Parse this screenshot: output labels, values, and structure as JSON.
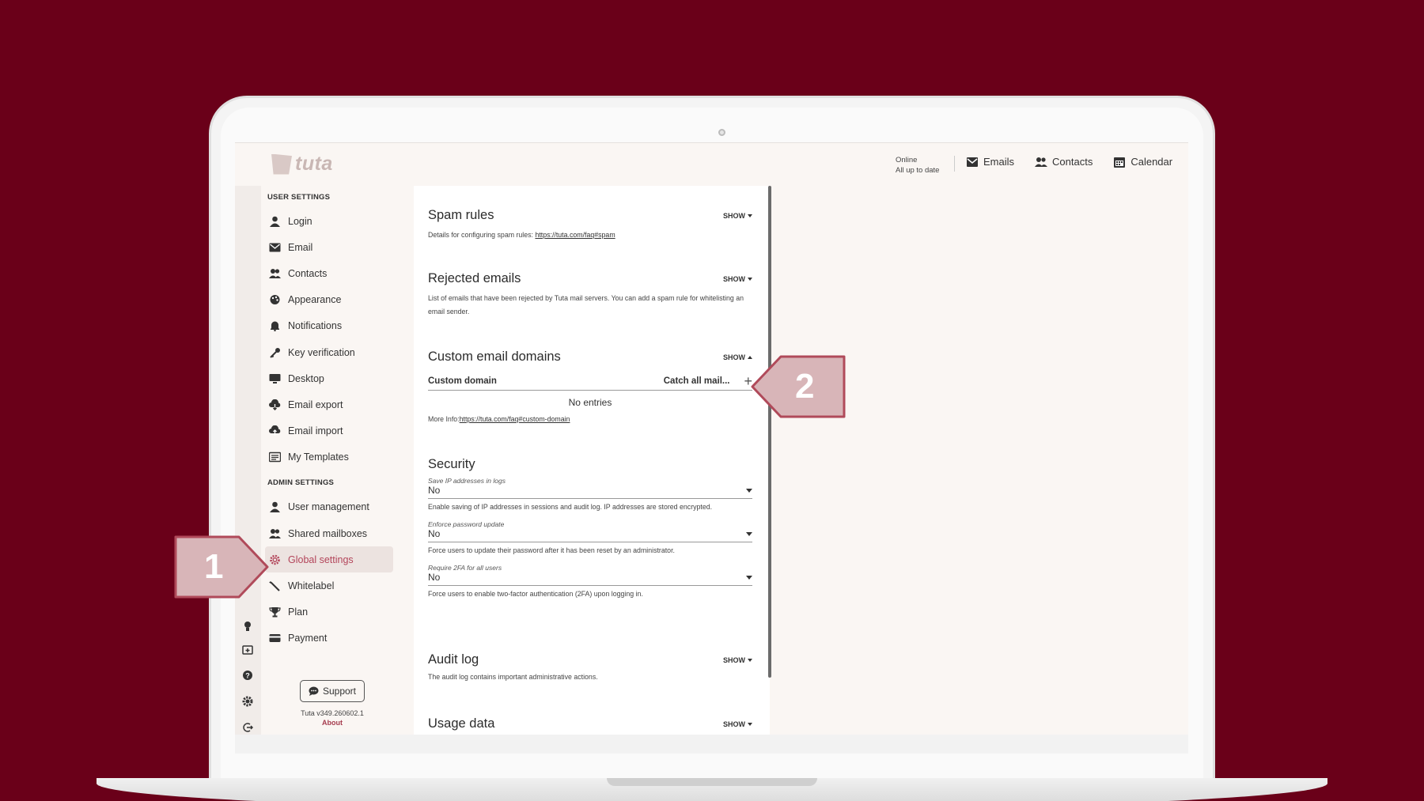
{
  "header": {
    "logo_text": "tuta",
    "status_line1": "Online",
    "status_line2": "All up to date",
    "nav": [
      {
        "label": "Emails",
        "icon": "mail-icon"
      },
      {
        "label": "Contacts",
        "icon": "contacts-icon"
      },
      {
        "label": "Calendar",
        "icon": "calendar-icon"
      }
    ]
  },
  "sidebar": {
    "user_settings_label": "USER SETTINGS",
    "user_items": [
      {
        "label": "Login",
        "icon": "person-icon"
      },
      {
        "label": "Email",
        "icon": "mail-icon"
      },
      {
        "label": "Contacts",
        "icon": "contacts-icon"
      },
      {
        "label": "Appearance",
        "icon": "palette-icon"
      },
      {
        "label": "Notifications",
        "icon": "bell-icon"
      },
      {
        "label": "Key verification",
        "icon": "key-icon"
      },
      {
        "label": "Desktop",
        "icon": "monitor-icon"
      },
      {
        "label": "Email export",
        "icon": "cloud-download-icon"
      },
      {
        "label": "Email import",
        "icon": "cloud-upload-icon"
      },
      {
        "label": "My Templates",
        "icon": "template-icon"
      }
    ],
    "admin_settings_label": "ADMIN SETTINGS",
    "admin_items": [
      {
        "label": "User management",
        "icon": "person-icon"
      },
      {
        "label": "Shared mailboxes",
        "icon": "contacts-icon"
      },
      {
        "label": "Global settings",
        "icon": "gear-icon",
        "active": true
      },
      {
        "label": "Whitelabel",
        "icon": "wand-icon"
      },
      {
        "label": "Plan",
        "icon": "trophy-icon"
      },
      {
        "label": "Payment",
        "icon": "card-icon"
      }
    ],
    "support_label": "Support",
    "version": "Tuta v349.260602.1",
    "about_label": "About"
  },
  "main": {
    "spam": {
      "title": "Spam rules",
      "show": "SHOW",
      "desc": "Details for configuring spam rules: ",
      "link": "https://tuta.com/faq#spam"
    },
    "rejected": {
      "title": "Rejected emails",
      "show": "SHOW",
      "desc": "List of emails that have been rejected by Tuta mail servers. You can add a spam rule for whitelisting an email sender."
    },
    "domains": {
      "title": "Custom email domains",
      "show": "SHOW",
      "col1": "Custom domain",
      "col2": "Catch all mail...",
      "add": "+",
      "empty": "No entries",
      "more_info": "More Info:",
      "link": "https://tuta.com/faq#custom-domain"
    },
    "security": {
      "title": "Security",
      "fields": [
        {
          "label": "Save IP addresses in logs",
          "value": "No",
          "help": "Enable saving of IP addresses in sessions and audit log. IP addresses are stored encrypted."
        },
        {
          "label": "Enforce password update",
          "value": "No",
          "help": "Force users to update their password after it has been reset by an administrator."
        },
        {
          "label": "Require 2FA for all users",
          "value": "No",
          "help": "Force users to enable two-factor authentication (2FA) upon logging in."
        }
      ]
    },
    "audit": {
      "title": "Audit log",
      "show": "SHOW",
      "desc": "The audit log contains important administrative actions."
    },
    "usage": {
      "title": "Usage data",
      "show": "SHOW"
    }
  },
  "callouts": {
    "one": "1",
    "two": "2",
    "color": "#d8b5b8",
    "border": "#b04a5a"
  },
  "colors": {
    "background": "#6a0019",
    "accent": "#b3455a"
  }
}
